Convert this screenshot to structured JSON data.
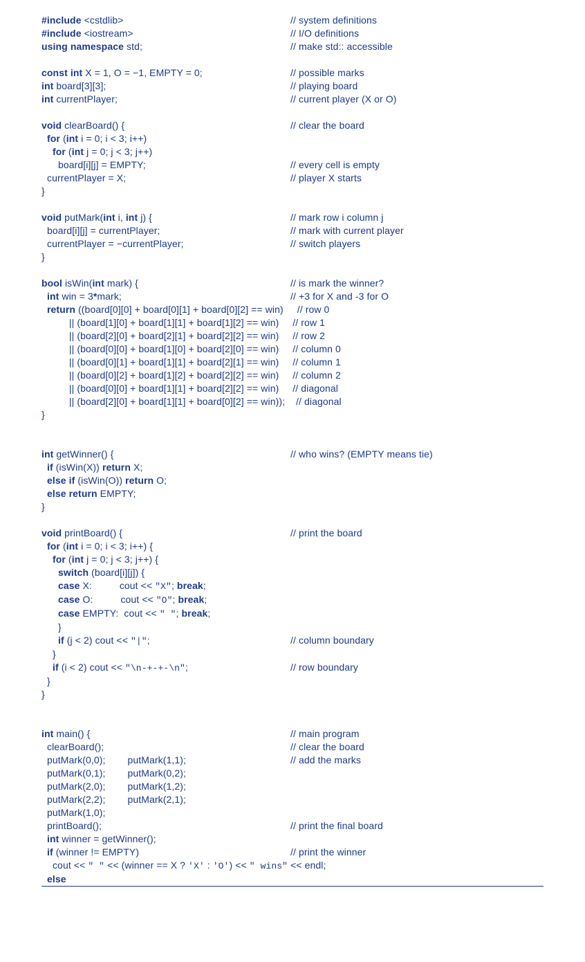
{
  "code_color": "#1e3a8a",
  "lines": [
    {
      "html": "<span class='kw'>#include</span> &lt;cstdlib&gt;",
      "comment": "// system definitions"
    },
    {
      "html": "<span class='kw'>#include</span> &lt;iostream&gt;",
      "comment": "// I/O definitions"
    },
    {
      "html": "<span class='kw'>using namespace</span> std;",
      "comment": "// make std:: accessible"
    },
    {
      "html": "",
      "comment": ""
    },
    {
      "html": "<span class='kw'>const int</span> X = 1, O = &minus;1, EMPTY = 0;",
      "comment": "// possible marks"
    },
    {
      "html": "<span class='kw'>int</span> board[3][3];",
      "comment": "// playing board"
    },
    {
      "html": "<span class='kw'>int</span> currentPlayer;",
      "comment": "// current player (X or O)"
    },
    {
      "html": "",
      "comment": ""
    },
    {
      "html": "<span class='kw'>void</span> clearBoard() {",
      "comment": "// clear the board"
    },
    {
      "html": "&nbsp;&nbsp;<span class='kw'>for</span> (<span class='kw'>int</span> i = 0; i &lt; 3; i++)",
      "comment": ""
    },
    {
      "html": "&nbsp;&nbsp;&nbsp;&nbsp;<span class='kw'>for</span> (<span class='kw'>int</span> j = 0; j &lt; 3; j++)",
      "comment": ""
    },
    {
      "html": "&nbsp;&nbsp;&nbsp;&nbsp;&nbsp;&nbsp;board[i][j] = EMPTY;",
      "comment": "// every cell is empty"
    },
    {
      "html": "&nbsp;&nbsp;currentPlayer = X;",
      "comment": "// player X starts"
    },
    {
      "html": "}",
      "comment": ""
    },
    {
      "html": "",
      "comment": ""
    },
    {
      "html": "<span class='kw'>void</span> putMark(<span class='kw'>int</span> i, <span class='kw'>int</span> j) {",
      "comment": "// mark row i column j"
    },
    {
      "html": "&nbsp;&nbsp;board[i][j] = currentPlayer;",
      "comment": "// mark with current player"
    },
    {
      "html": "&nbsp;&nbsp;currentPlayer = &minus;currentPlayer;",
      "comment": "// switch players"
    },
    {
      "html": "}",
      "comment": ""
    },
    {
      "html": "",
      "comment": ""
    },
    {
      "html": "<span class='kw'>bool</span> isWin(<span class='kw'>int</span> mark) {",
      "comment": "// is mark the winner?"
    },
    {
      "html": "&nbsp;&nbsp;<span class='kw'>int</span> win = 3<span class='kw'>*</span>mark;",
      "comment": "// +3 for X and -3 for O"
    },
    {
      "html": "&nbsp;&nbsp;<span class='kw'>return</span> ((board[0][0] + board[0][1] + board[0][2] == win)&nbsp;&nbsp;&nbsp;&nbsp;&nbsp;// row 0",
      "comment": ""
    },
    {
      "html": "&nbsp;&nbsp;&nbsp;&nbsp;&nbsp;&nbsp;&nbsp;&nbsp;&nbsp;&nbsp;|| (board[1][0] + board[1][1] + board[1][2] == win)&nbsp;&nbsp;&nbsp;&nbsp;&nbsp;// row 1",
      "comment": ""
    },
    {
      "html": "&nbsp;&nbsp;&nbsp;&nbsp;&nbsp;&nbsp;&nbsp;&nbsp;&nbsp;&nbsp;|| (board[2][0] + board[2][1] + board[2][2] == win)&nbsp;&nbsp;&nbsp;&nbsp;&nbsp;// row 2",
      "comment": ""
    },
    {
      "html": "&nbsp;&nbsp;&nbsp;&nbsp;&nbsp;&nbsp;&nbsp;&nbsp;&nbsp;&nbsp;|| (board[0][0] + board[1][0] + board[2][0] == win)&nbsp;&nbsp;&nbsp;&nbsp;&nbsp;// column 0",
      "comment": ""
    },
    {
      "html": "&nbsp;&nbsp;&nbsp;&nbsp;&nbsp;&nbsp;&nbsp;&nbsp;&nbsp;&nbsp;|| (board[0][1] + board[1][1] + board[2][1] == win)&nbsp;&nbsp;&nbsp;&nbsp;&nbsp;// column 1",
      "comment": ""
    },
    {
      "html": "&nbsp;&nbsp;&nbsp;&nbsp;&nbsp;&nbsp;&nbsp;&nbsp;&nbsp;&nbsp;|| (board[0][2] + board[1][2] + board[2][2] == win)&nbsp;&nbsp;&nbsp;&nbsp;&nbsp;// column 2",
      "comment": ""
    },
    {
      "html": "&nbsp;&nbsp;&nbsp;&nbsp;&nbsp;&nbsp;&nbsp;&nbsp;&nbsp;&nbsp;|| (board[0][0] + board[1][1] + board[2][2] == win)&nbsp;&nbsp;&nbsp;&nbsp;&nbsp;// diagonal",
      "comment": ""
    },
    {
      "html": "&nbsp;&nbsp;&nbsp;&nbsp;&nbsp;&nbsp;&nbsp;&nbsp;&nbsp;&nbsp;|| (board[2][0] + board[1][1] + board[0][2] == win));&nbsp;&nbsp;&nbsp;&nbsp;// diagonal",
      "comment": ""
    },
    {
      "html": "}",
      "comment": ""
    },
    {
      "html": "",
      "comment": ""
    },
    {
      "html": "",
      "comment": ""
    },
    {
      "html": "<span class='kw'>int</span> getWinner() {",
      "comment": "// who wins? (EMPTY means tie)"
    },
    {
      "html": "&nbsp;&nbsp;<span class='kw'>if</span> (isWin(X)) <span class='kw'>return</span> X;",
      "comment": ""
    },
    {
      "html": "&nbsp;&nbsp;<span class='kw'>else if</span> (isWin(O)) <span class='kw'>return</span> O;",
      "comment": ""
    },
    {
      "html": "&nbsp;&nbsp;<span class='kw'>else return</span> EMPTY;",
      "comment": ""
    },
    {
      "html": "}",
      "comment": ""
    },
    {
      "html": "",
      "comment": ""
    },
    {
      "html": "<span class='kw'>void</span> printBoard() {",
      "comment": "// print the board"
    },
    {
      "html": "&nbsp;&nbsp;<span class='kw'>for</span> (<span class='kw'>int</span> i = 0; i &lt; 3; i++) {",
      "comment": ""
    },
    {
      "html": "&nbsp;&nbsp;&nbsp;&nbsp;<span class='kw'>for</span> (<span class='kw'>int</span> j = 0; j &lt; 3; j++) {",
      "comment": ""
    },
    {
      "html": "&nbsp;&nbsp;&nbsp;&nbsp;&nbsp;&nbsp;<span class='kw'>switch</span> (board[i][j]) {",
      "comment": ""
    },
    {
      "html": "&nbsp;&nbsp;&nbsp;&nbsp;&nbsp;&nbsp;<span class='kw'>case</span> X:&nbsp;&nbsp;&nbsp;&nbsp;&nbsp;&nbsp;&nbsp;&nbsp;&nbsp;&nbsp;cout &lt;&lt; <span class='mono'>&quot;X&quot;</span>; <span class='kw'>break</span>;",
      "comment": ""
    },
    {
      "html": "&nbsp;&nbsp;&nbsp;&nbsp;&nbsp;&nbsp;<span class='kw'>case</span> O:&nbsp;&nbsp;&nbsp;&nbsp;&nbsp;&nbsp;&nbsp;&nbsp;&nbsp;&nbsp;cout &lt;&lt; <span class='mono'>&quot;O&quot;</span>; <span class='kw'>break</span>;",
      "comment": ""
    },
    {
      "html": "&nbsp;&nbsp;&nbsp;&nbsp;&nbsp;&nbsp;<span class='kw'>case</span> EMPTY:&nbsp;&nbsp;cout &lt;&lt; <span class='mono'>&quot; &quot;</span>; <span class='kw'>break</span>;",
      "comment": ""
    },
    {
      "html": "&nbsp;&nbsp;&nbsp;&nbsp;&nbsp;&nbsp;}",
      "comment": ""
    },
    {
      "html": "&nbsp;&nbsp;&nbsp;&nbsp;&nbsp;&nbsp;<span class='kw'>if</span> (j &lt; 2) cout &lt;&lt; <span class='mono'>&quot;|&quot;</span>;",
      "comment": "// column boundary"
    },
    {
      "html": "&nbsp;&nbsp;&nbsp;&nbsp;}",
      "comment": ""
    },
    {
      "html": "&nbsp;&nbsp;&nbsp;&nbsp;<span class='kw'>if</span> (i &lt; 2) cout &lt;&lt; <span class='mono'>&quot;\\n-+-+-\\n&quot;</span>;",
      "comment": "// row boundary"
    },
    {
      "html": "&nbsp;&nbsp;}",
      "comment": ""
    },
    {
      "html": "}",
      "comment": ""
    },
    {
      "html": "",
      "comment": ""
    },
    {
      "html": "",
      "comment": ""
    },
    {
      "html": "<span class='kw'>int</span> main() {",
      "comment": "// main program"
    },
    {
      "html": "&nbsp;&nbsp;clearBoard();",
      "comment": "// clear the board"
    },
    {
      "html": "&nbsp;&nbsp;putMark(0,0);&nbsp;&nbsp;&nbsp;&nbsp;&nbsp;&nbsp;&nbsp;&nbsp;putMark(1,1);",
      "comment": "// add the marks"
    },
    {
      "html": "&nbsp;&nbsp;putMark(0,1);&nbsp;&nbsp;&nbsp;&nbsp;&nbsp;&nbsp;&nbsp;&nbsp;putMark(0,2);",
      "comment": ""
    },
    {
      "html": "&nbsp;&nbsp;putMark(2,0);&nbsp;&nbsp;&nbsp;&nbsp;&nbsp;&nbsp;&nbsp;&nbsp;putMark(1,2);",
      "comment": ""
    },
    {
      "html": "&nbsp;&nbsp;putMark(2,2);&nbsp;&nbsp;&nbsp;&nbsp;&nbsp;&nbsp;&nbsp;&nbsp;putMark(2,1);",
      "comment": ""
    },
    {
      "html": "&nbsp;&nbsp;putMark(1,0);",
      "comment": ""
    },
    {
      "html": "&nbsp;&nbsp;printBoard();",
      "comment": "// print the final board"
    },
    {
      "html": "&nbsp;&nbsp;<span class='kw'>int</span> winner = getWinner();",
      "comment": ""
    },
    {
      "html": "&nbsp;&nbsp;<span class='kw'>if</span> (winner != EMPTY)",
      "comment": "// print the winner"
    },
    {
      "html": "&nbsp;&nbsp;&nbsp;&nbsp;cout &lt;&lt; <span class='mono'>&quot; &quot;</span> &lt;&lt; (winner == X ? <span class='mono'>'X'</span> : <span class='mono'>'O'</span>) &lt;&lt; <span class='mono'>&quot; wins&quot;</span> &lt;&lt; endl;",
      "comment": ""
    },
    {
      "html": "&nbsp;&nbsp;<span class='kw'>else</span>",
      "comment": ""
    }
  ]
}
